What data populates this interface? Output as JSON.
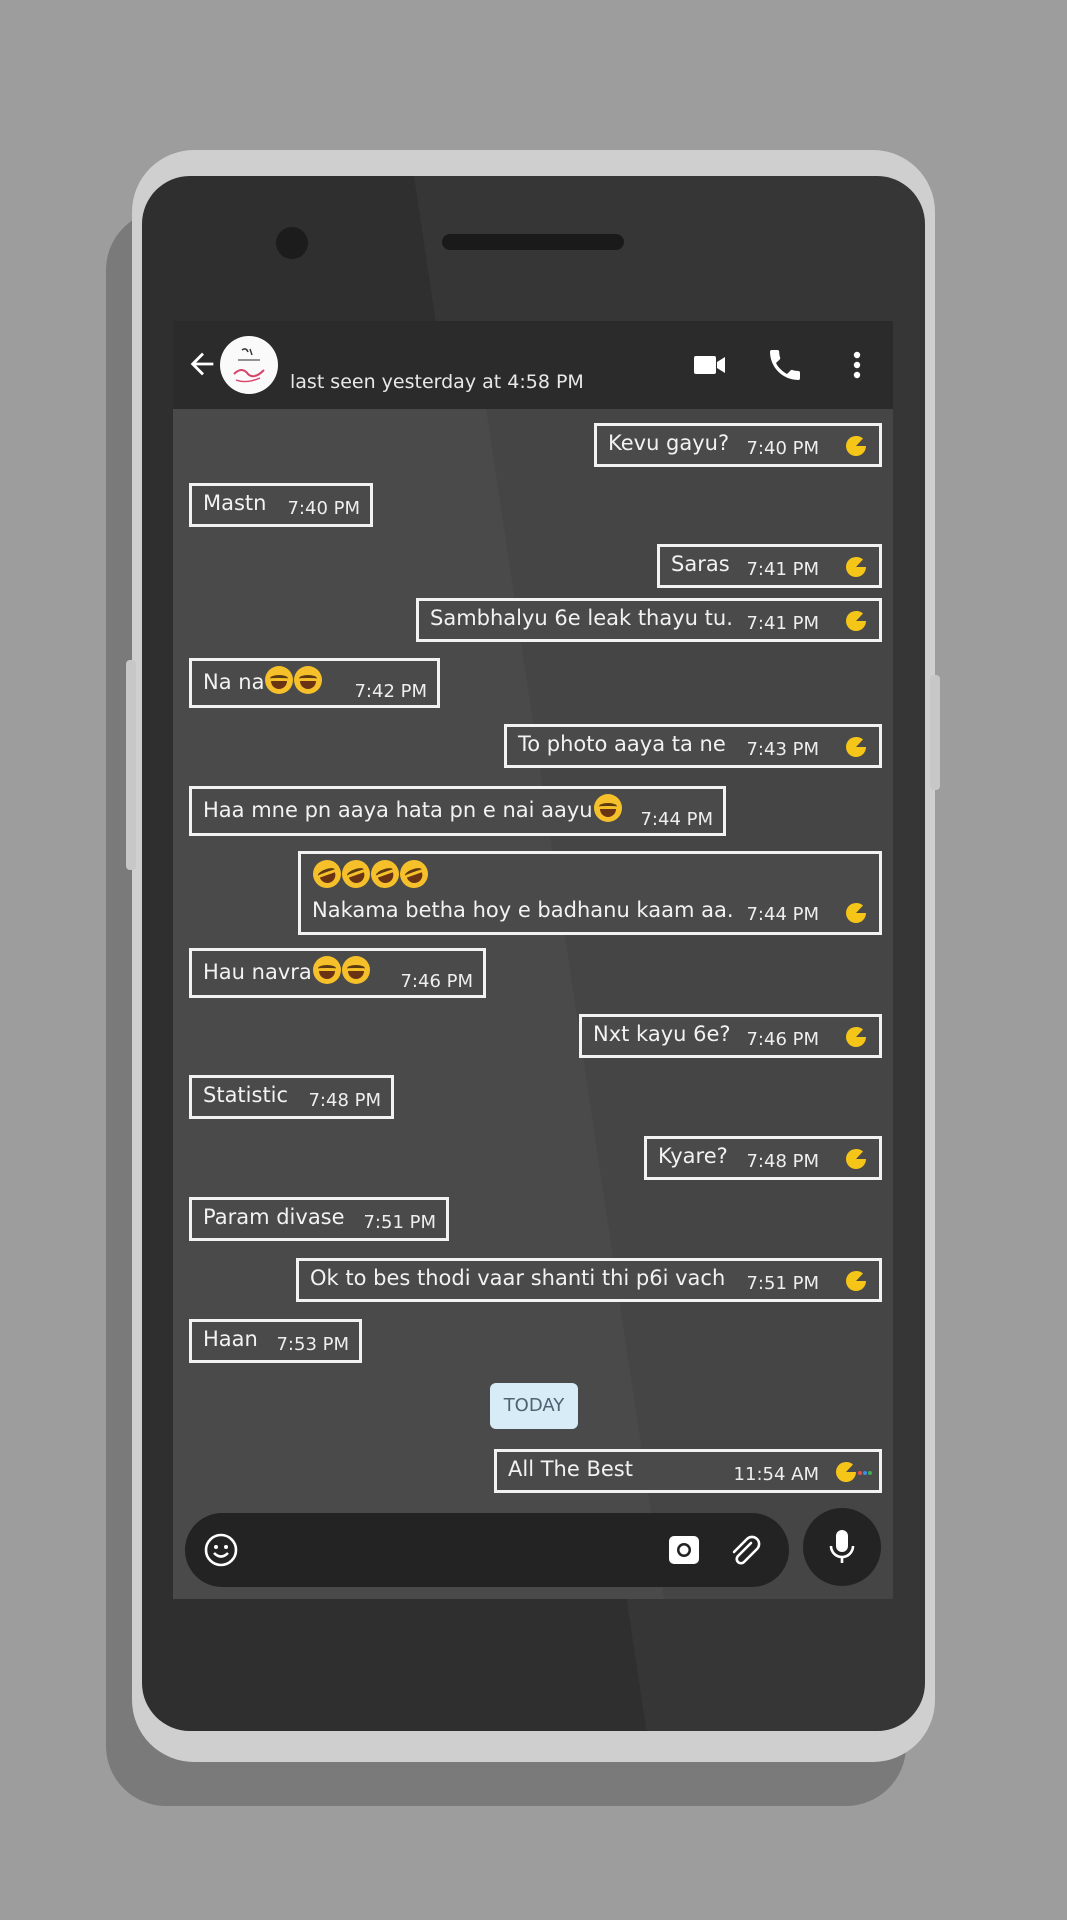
{
  "header": {
    "last_seen": "last seen yesterday at 4:58 PM",
    "icons": [
      "back-arrow-icon",
      "avatar",
      "video-call-icon",
      "voice-call-icon",
      "more-options-icon"
    ]
  },
  "messages": [
    {
      "dir": "out",
      "text": "Kevu gayu?",
      "time": "7:40 PM"
    },
    {
      "dir": "in",
      "text": "Mastn",
      "time": "7:40 PM"
    },
    {
      "dir": "out",
      "text": "Saras",
      "time": "7:41 PM"
    },
    {
      "dir": "out",
      "text": "Sambhalyu 6e leak thayu tu.",
      "time": "7:41 PM"
    },
    {
      "dir": "in",
      "text": "Na na",
      "emoji": "😂😂",
      "time": "7:42 PM"
    },
    {
      "dir": "out",
      "text": "To photo aaya ta ne",
      "time": "7:43 PM"
    },
    {
      "dir": "in",
      "text": "Haa mne pn aaya hata pn e nai aayu",
      "emoji": "😂",
      "time": "7:44 PM"
    },
    {
      "dir": "out",
      "emoji_line": "🤣🤣🤣🤣",
      "text": "Nakama betha hoy e badhanu kaam aa.",
      "time": "7:44 PM"
    },
    {
      "dir": "in",
      "text": "Hau navra",
      "emoji": "😂😂",
      "time": "7:46 PM"
    },
    {
      "dir": "out",
      "text": "Nxt kayu 6e?",
      "time": "7:46 PM"
    },
    {
      "dir": "in",
      "text": "Statistic",
      "time": "7:48 PM"
    },
    {
      "dir": "out",
      "text": "Kyare?",
      "time": "7:48 PM"
    },
    {
      "dir": "in",
      "text": "Param divase",
      "time": "7:51 PM"
    },
    {
      "dir": "out",
      "text": "Ok to bes thodi vaar shanti thi p6i vach",
      "time": "7:51 PM"
    },
    {
      "dir": "in",
      "text": "Haan",
      "time": "7:53 PM"
    }
  ],
  "date_divider": "TODAY",
  "last_message": {
    "dir": "out",
    "text": "All The Best",
    "time": "11:54 AM",
    "status": "sending"
  },
  "input_bar": {
    "icons": [
      "smiley-icon",
      "camera-icon",
      "attach-icon",
      "mic-icon"
    ]
  },
  "colors": {
    "accent_tick": "#f5c518",
    "bubble_border": "#f2f2f2",
    "chat_bg": "#4a4a4a",
    "chip_bg": "#d8ecf7"
  }
}
